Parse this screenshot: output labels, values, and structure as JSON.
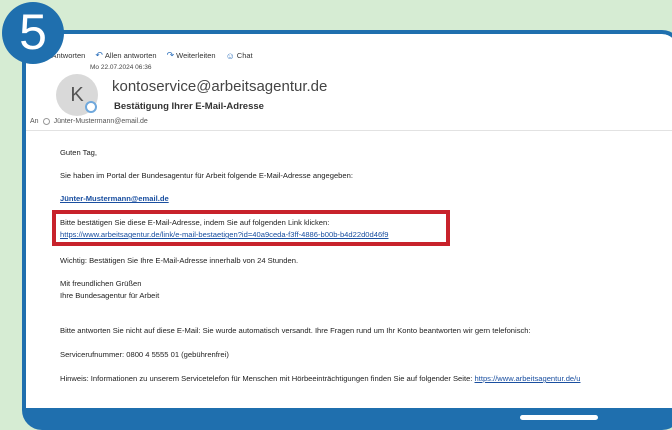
{
  "step": {
    "number": "5"
  },
  "toolbar": {
    "reply": "Antworten",
    "reply_all": "Allen antworten",
    "forward": "Weiterleiten",
    "chat": "Chat"
  },
  "email": {
    "date": "Mo 22.07.2024 06:36",
    "avatar_initial": "K",
    "sender": "kontoservice@arbeitsagentur.de",
    "subject": "Bestätigung Ihrer E-Mail-Adresse",
    "to_label": "An",
    "to_address": "Jünter-Mustermann@email.de",
    "greeting": "Guten Tag,",
    "line1": "Sie haben im Portal der Bundesagentur für Arbeit folgende E-Mail-Adresse angegeben:",
    "entered_email": "Jünter-Mustermann@email.de",
    "confirm_text": "Bitte bestätigen Sie diese E-Mail-Adresse, indem Sie auf folgenden Link klicken:",
    "confirm_link": "https://www.arbeitsagentur.de/link/e-mail-bestaetigen?id=40a9ceda-f3ff-4886-b00b-b4d22d0d46f9",
    "important": "Wichtig: Bestätigen Sie Ihre E-Mail-Adresse innerhalb von 24 Stunden.",
    "closing1": "Mit freundlichen Grüßen",
    "closing2": "Ihre Bundesagentur für Arbeit",
    "no_reply": "Bitte antworten Sie nicht auf diese E-Mail: Sie wurde automatisch versandt. Ihre Fragen rund um Ihr Konto beantworten wir gern telefonisch:",
    "service_number": "Servicerufnummer: 0800 4 5555 01 (gebührenfrei)",
    "hint_text": "Hinweis: Informationen zu unserem Servicetelefon für Menschen mit Hörbeeinträchtigungen finden Sie auf folgender Seite: ",
    "hint_link": "https://www.arbeitsagentur.de/u"
  },
  "colors": {
    "background": "#d6ecd3",
    "frame": "#1f6fae",
    "highlight": "#c8222b",
    "link": "#1a4fa0"
  },
  "icons": [
    "reply-icon",
    "reply-all-icon",
    "forward-icon",
    "chat-icon",
    "presence-icon"
  ]
}
